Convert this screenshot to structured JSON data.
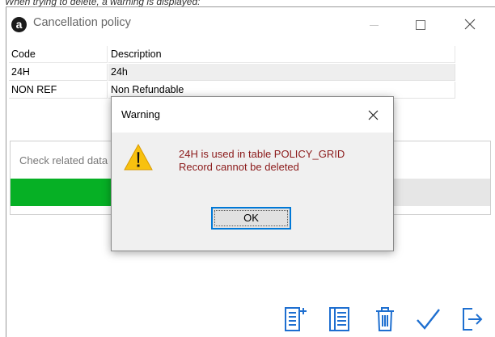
{
  "caption": "When trying to delete, a warning is displayed:",
  "window": {
    "logo_letter": "a",
    "title": "Cancellation policy"
  },
  "grid": {
    "columns": [
      "Code",
      "Description"
    ],
    "rows": [
      [
        "24H",
        "24h"
      ],
      [
        "NON REF",
        "Non Refundable"
      ]
    ]
  },
  "check_panel": {
    "text": "Check related data",
    "progress": 0.42,
    "progress_color": "#06b025"
  },
  "toolbar": {
    "icons": [
      "add-record-icon",
      "list-view-icon",
      "delete-icon",
      "confirm-check-icon",
      "exit-icon"
    ],
    "icon_color": "#1e6fd0"
  },
  "dialog": {
    "title": "Warning",
    "message_line1": "24H is used in table POLICY_GRID",
    "message_line2": "Record cannot be deleted",
    "ok_label": "OK",
    "message_color": "#8b1a1a",
    "accent": "#0078d7"
  }
}
